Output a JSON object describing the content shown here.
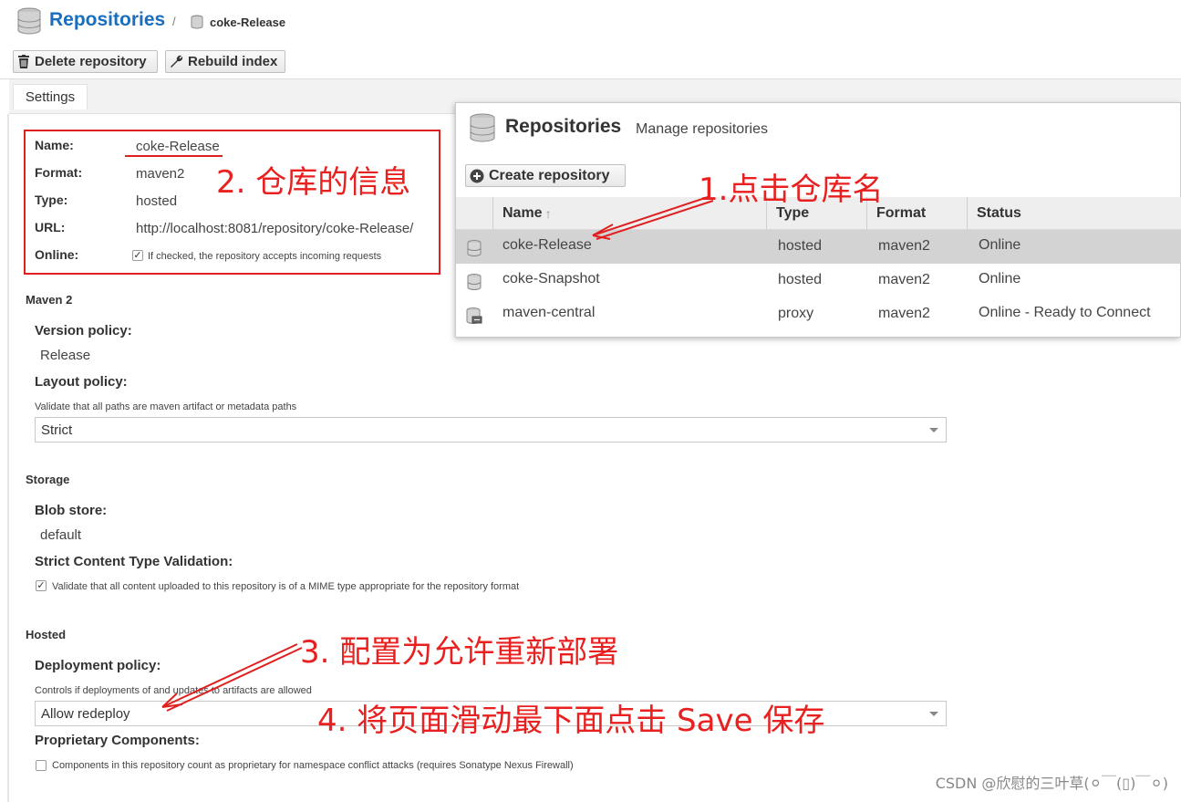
{
  "header": {
    "title": "Repositories",
    "separator": "/",
    "breadcrumb_current": "coke-Release"
  },
  "toolbar": {
    "delete_label": "Delete repository",
    "rebuild_label": "Rebuild index"
  },
  "tabs": {
    "settings_label": "Settings"
  },
  "details": {
    "name_label": "Name:",
    "name_value": "coke-Release",
    "format_label": "Format:",
    "format_value": "maven2",
    "type_label": "Type:",
    "type_value": "hosted",
    "url_label": "URL:",
    "url_value": "http://localhost:8081/repository/coke-Release/",
    "online_label": "Online:",
    "online_checked": true,
    "online_help": "If checked, the repository accepts incoming requests"
  },
  "maven2": {
    "section": "Maven 2",
    "version_policy_label": "Version policy:",
    "version_policy_value": "Release",
    "layout_policy_label": "Layout policy:",
    "layout_policy_help": "Validate that all paths are maven artifact or metadata paths",
    "layout_policy_value": "Strict"
  },
  "storage": {
    "section": "Storage",
    "blob_label": "Blob store:",
    "blob_value": "default",
    "strict_label": "Strict Content Type Validation:",
    "strict_checked": true,
    "strict_help": "Validate that all content uploaded to this repository is of a MIME type appropriate for the repository format"
  },
  "hosted": {
    "section": "Hosted",
    "deploy_label": "Deployment policy:",
    "deploy_help": "Controls if deployments of and updates to artifacts are allowed",
    "deploy_value": "Allow redeploy",
    "proprietary_label": "Proprietary Components:",
    "proprietary_checked": false,
    "proprietary_help": "Components in this repository count as proprietary for namespace conflict attacks (requires Sonatype Nexus Firewall)"
  },
  "overlay": {
    "title": "Repositories",
    "subtitle": "Manage repositories",
    "create_label": "Create repository",
    "columns": {
      "name": "Name",
      "sort": "↑",
      "type": "Type",
      "format": "Format",
      "status": "Status"
    },
    "rows": [
      {
        "name": "coke-Release",
        "type": "hosted",
        "format": "maven2",
        "status": "Online",
        "icon": "database-icon",
        "selected": true
      },
      {
        "name": "coke-Snapshot",
        "type": "hosted",
        "format": "maven2",
        "status": "Online",
        "icon": "database-icon",
        "selected": false
      },
      {
        "name": "maven-central",
        "type": "proxy",
        "format": "maven2",
        "status": "Online - Ready to Connect",
        "icon": "proxy-database-icon",
        "selected": false
      }
    ]
  },
  "annotations": {
    "step1": "1.点击仓库名",
    "step2": "2. 仓库的信息",
    "step3": "3. 配置为允许重新部署",
    "step4": "4. 将页面滑动最下面点击 Save 保存",
    "color": "#e82020"
  },
  "watermark": "CSDN @欣慰的三叶草(⚪￣(▯)￣⚪)",
  "colors": {
    "accent": "#1a6ebc",
    "selected_row": "#d3d3d3",
    "annotation": "#e02020"
  }
}
